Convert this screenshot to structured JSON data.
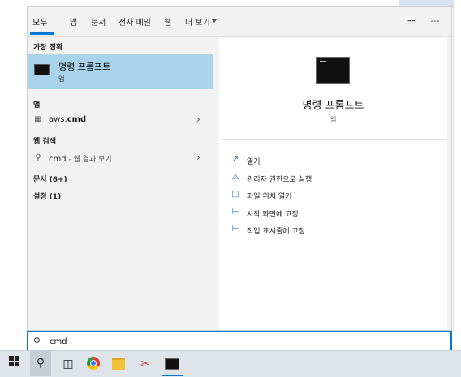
{
  "tabs": [
    {
      "label": "모두",
      "active": true
    },
    {
      "label": "앱"
    },
    {
      "label": "문서"
    },
    {
      "label": "전자 메일"
    },
    {
      "label": "웹"
    },
    {
      "label": "더 보기"
    }
  ],
  "left": {
    "best_match_heading": "가장 정확",
    "best_match": {
      "title": "명령 프롬프트",
      "subtitle": "앱",
      "icon": "cmd-icon"
    },
    "apps_heading": "앱",
    "apps_item": {
      "prefix": "aws.",
      "bold": "cmd"
    },
    "web_heading": "웹 검색",
    "web_item": {
      "prefix": "cmd",
      "suffix": " - 웹 결과 보기"
    },
    "documents": "문서 (6+)",
    "settings": "설정 (1)"
  },
  "preview": {
    "title": "명령 프롬프트",
    "subtitle": "앱",
    "actions": [
      {
        "label": "열기",
        "icon": "open-icon"
      },
      {
        "label": "관리자 권한으로 실행",
        "icon": "shield-icon"
      },
      {
        "label": "파일 위치 열기",
        "icon": "file-location-icon"
      },
      {
        "label": "시작 화면에 고정",
        "icon": "pin-icon"
      },
      {
        "label": "작업 표시줄에 고정",
        "icon": "pin-icon"
      }
    ]
  },
  "search": {
    "value": "cmd"
  },
  "colors": {
    "accent": "#0078d7",
    "selected": "#a9d3eb"
  }
}
